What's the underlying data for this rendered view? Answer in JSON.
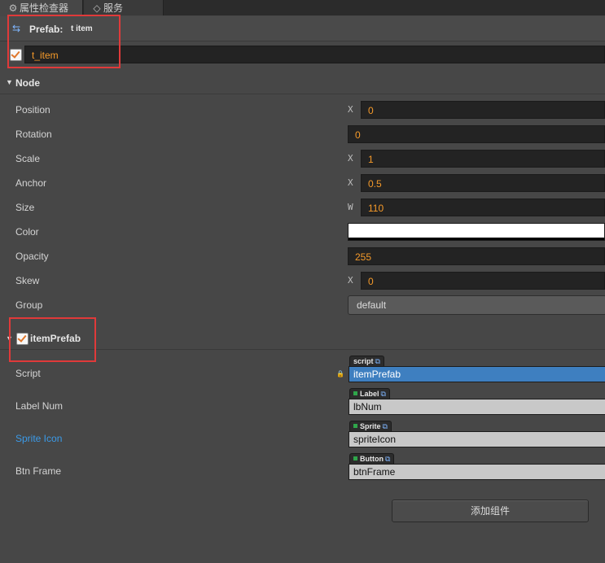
{
  "tabs": [
    {
      "label": "属性检查器",
      "icon": "gear-icon"
    },
    {
      "label": "服务",
      "icon": "service-icon"
    }
  ],
  "prefab": {
    "label": "Prefab:",
    "name": "t item",
    "icon": "prefab-link-icon"
  },
  "node_name": {
    "checked": true,
    "value": "t_item"
  },
  "node_section": {
    "title": "Node",
    "properties": [
      {
        "label": "Position",
        "axis": "X",
        "value": "0"
      },
      {
        "label": "Rotation",
        "axis": "",
        "value": "0"
      },
      {
        "label": "Scale",
        "axis": "X",
        "value": "1"
      },
      {
        "label": "Anchor",
        "axis": "X",
        "value": "0.5"
      },
      {
        "label": "Size",
        "axis": "W",
        "value": "110"
      },
      {
        "label": "Color",
        "color": "#ffffff"
      },
      {
        "label": "Opacity",
        "axis": "",
        "value": "255"
      },
      {
        "label": "Skew",
        "axis": "X",
        "value": "0"
      },
      {
        "label": "Group",
        "select": "default"
      }
    ]
  },
  "component": {
    "title": "itemPrefab",
    "checked": true,
    "properties": [
      {
        "label": "Script",
        "type_tag": "script",
        "value": "itemPrefab",
        "locked": true
      },
      {
        "label": "Label Num",
        "type_tag": "Label",
        "value": "lbNum"
      },
      {
        "label": "Sprite Icon",
        "type_tag": "Sprite",
        "value": "spriteIcon",
        "label_color": "#3b9ae8"
      },
      {
        "label": "Btn Frame",
        "type_tag": "Button",
        "value": "btnFrame"
      }
    ]
  },
  "add_component_label": "添加组件",
  "colors": {
    "accent_value": "#f59a2a",
    "annotation": "#e03a3a",
    "script_field": "#3e7fc0"
  }
}
